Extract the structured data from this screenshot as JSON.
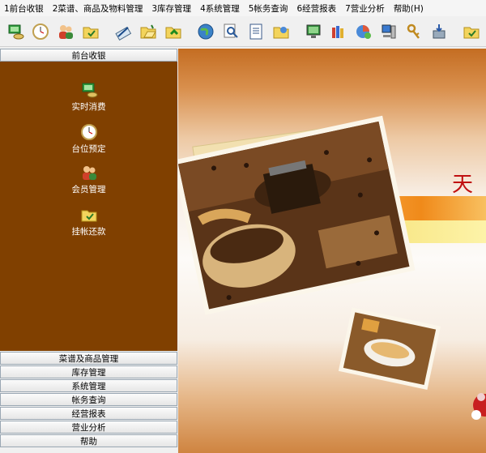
{
  "menu": [
    "1前台收银",
    "2菜谱、商品及物料管理",
    "3库存管理",
    "4系统管理",
    "5帐务查询",
    "6经营报表",
    "7营业分析",
    "帮助(H)"
  ],
  "toolbar_icons": [
    "cashier-icon",
    "clock-icon",
    "members-icon",
    "folder-check-icon",
    "edit-icon",
    "folder-open-icon",
    "folder-green-icon",
    "globe-icon",
    "search-icon",
    "document-icon",
    "folder-blue-icon",
    "monitor-icon",
    "books-icon",
    "chart-icon",
    "computer-icon",
    "key-icon",
    "install-icon",
    "folder-yellow-icon"
  ],
  "panel": {
    "title": "前台收银",
    "items": [
      {
        "label": "实时消费",
        "icon": "cashier-icon"
      },
      {
        "label": "台位预定",
        "icon": "clock-icon"
      },
      {
        "label": "会员管理",
        "icon": "members-icon"
      },
      {
        "label": "挂帐还款",
        "icon": "folder-check-icon"
      }
    ],
    "sections": [
      "菜谱及商品管理",
      "库存管理",
      "系统管理",
      "帐务查询",
      "经营报表",
      "营业分析",
      "帮助"
    ]
  },
  "banner": {
    "text": "天"
  },
  "colors": {
    "panel_bg": "#804000",
    "accent_orange": "#f08a1a",
    "banner_red": "#c01010"
  }
}
